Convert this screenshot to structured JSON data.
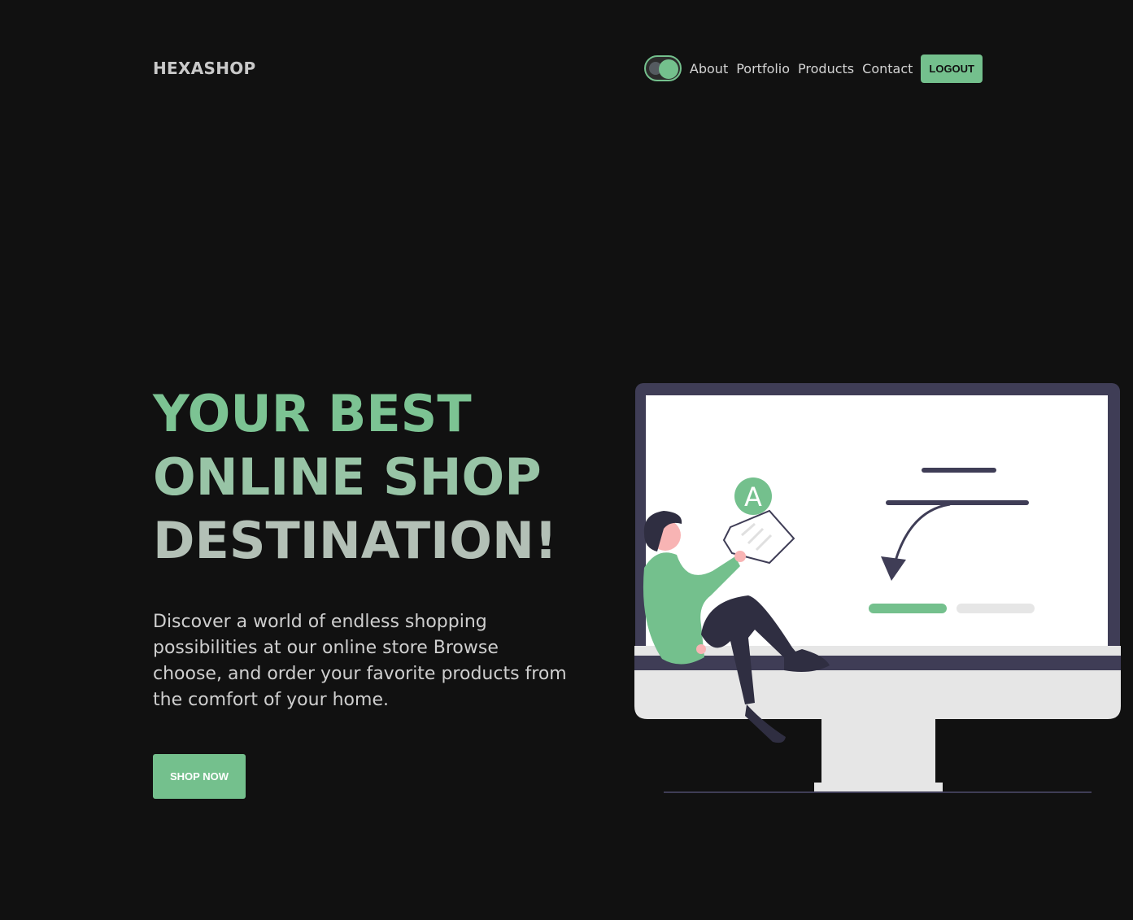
{
  "header": {
    "brand": "HEXASHOP",
    "theme_toggle": "on",
    "nav": [
      "About",
      "Portfolio",
      "Products",
      "Contact"
    ],
    "logout_label": "LOGOUT"
  },
  "hero": {
    "title_lines": [
      "YOUR BEST",
      "ONLINE SHOP",
      "DESTINATION!"
    ],
    "description": "Discover a world of endless shopping possibilities at our online store Browse choose, and order your favorite products from the comfort of your home.",
    "cta_label": "SHOP NOW",
    "illustration_badge": "A"
  },
  "colors": {
    "background": "#111111",
    "accent": "#74c08d",
    "text": "#cfcfcf"
  }
}
